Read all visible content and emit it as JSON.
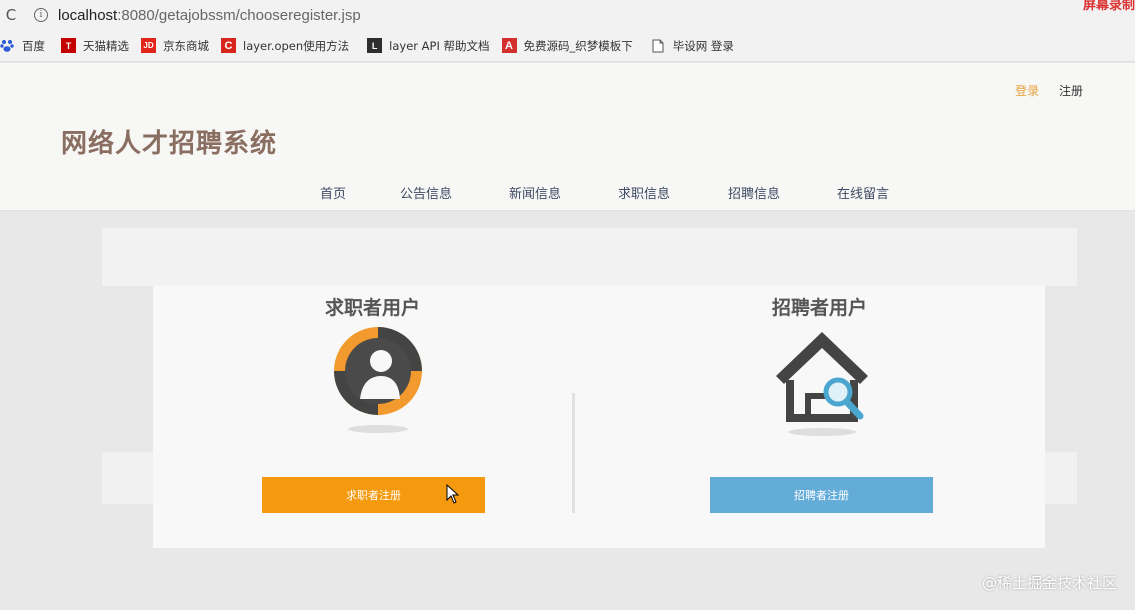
{
  "browser": {
    "url_host": "localhost",
    "url_rest": ":8080/getajobssm/chooseregister.jsp",
    "recording_badge": "屏幕录制"
  },
  "bookmarks": [
    {
      "label": "百度",
      "icon": "baidu-icon"
    },
    {
      "label": "天猫精选",
      "icon": "tmall-icon"
    },
    {
      "label": "京东商城",
      "icon": "jd-icon"
    },
    {
      "label": "layer.open使用方法",
      "icon": "csdn-icon"
    },
    {
      "label": "layer API 帮助文档",
      "icon": "layer-icon"
    },
    {
      "label": "免费源码_织梦模板下",
      "icon": "a-icon"
    },
    {
      "label": "毕设网 登录",
      "icon": "page-icon"
    }
  ],
  "header": {
    "login": "登录",
    "register": "注册",
    "site_title": "网络人才招聘系统"
  },
  "nav": [
    "首页",
    "公告信息",
    "新闻信息",
    "求职信息",
    "招聘信息",
    "在线留言"
  ],
  "jobseeker": {
    "title": "求职者用户",
    "button": "求职者注册"
  },
  "employer": {
    "title": "招聘者用户",
    "button": "招聘者注册"
  },
  "watermark": "@稀土掘金技术社区",
  "colors": {
    "accent_orange": "#f59a0e",
    "accent_blue": "#64acd8",
    "title_brown": "#8a6e62",
    "nav_text": "#3e4a63"
  }
}
